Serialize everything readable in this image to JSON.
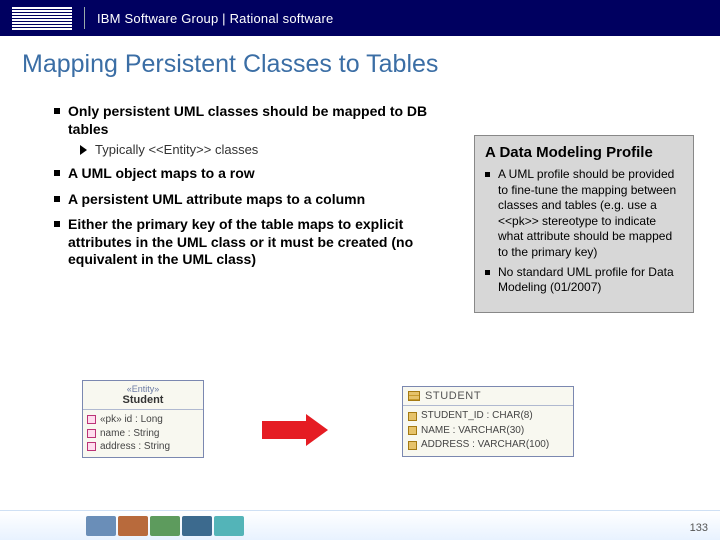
{
  "header": {
    "brand_text": "IBM Software Group | Rational software"
  },
  "title": "Mapping Persistent Classes to Tables",
  "bullets": {
    "b1": "Only persistent UML classes should be mapped to DB tables",
    "b1_sub": "Typically <<Entity>> classes",
    "b2": "A UML object maps to a row",
    "b3": "A persistent UML attribute maps to a column",
    "b4": "Either the primary key of the table maps to explicit attributes in the UML class or it must be created (no equivalent in the UML class)"
  },
  "sidebox": {
    "title": "A Data Modeling Profile",
    "s1": "A UML profile should be provided to fine-tune the mapping between classes and tables (e.g. use a <<pk>> stereotype to indicate what attribute should be mapped to the primary key)",
    "s2": "No standard UML profile for Data Modeling (01/2007)"
  },
  "uml": {
    "stereotype": "«Entity»",
    "classname": "Student",
    "attr1": "«pk» id : Long",
    "attr2": "name : String",
    "attr3": "address : String"
  },
  "table": {
    "name": "STUDENT",
    "col1": "STUDENT_ID : CHAR(8)",
    "col2": "NAME : VARCHAR(30)",
    "col3": "ADDRESS : VARCHAR(100)"
  },
  "footer": {
    "page": "133"
  }
}
